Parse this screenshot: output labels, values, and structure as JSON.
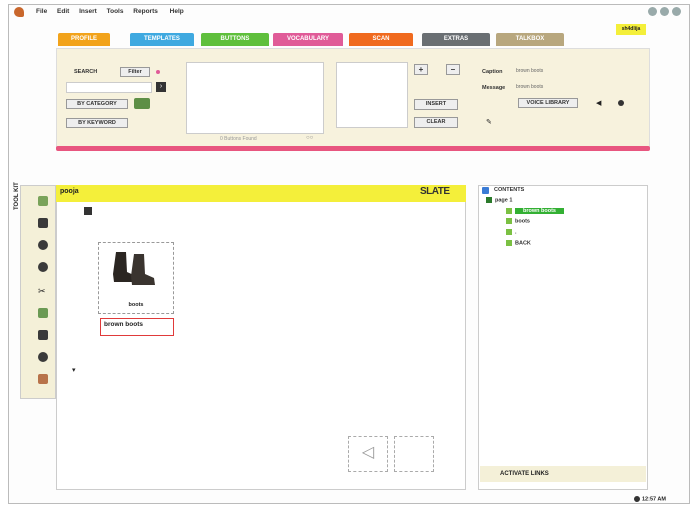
{
  "menu": [
    "File",
    "Edit",
    "Insert",
    "Tools",
    "Reports",
    "Help"
  ],
  "user_badge": "sh4dlija",
  "tabs": [
    {
      "label": "PROFILE",
      "color": "#f2a31b"
    },
    {
      "label": "TEMPLATES",
      "color": "#3fa9e0"
    },
    {
      "label": "BUTTONS",
      "color": "#5fbf3c"
    },
    {
      "label": "VOCABULARY",
      "color": "#e05b98"
    },
    {
      "label": "SCAN",
      "color": "#f06a1e"
    },
    {
      "label": "EXTRAS",
      "color": "#6a6f73"
    },
    {
      "label": "TALKBOX",
      "color": "#b8a77e"
    }
  ],
  "search": {
    "label": "SEARCH",
    "filter_label": "Filter",
    "by_category_label": "BY CATEGORY",
    "by_keyword_label": "BY KEYWORD",
    "hint": "0 Buttons Found"
  },
  "actions": {
    "insert_label": "INSERT",
    "clear_label": "CLEAR",
    "plus_label": "+",
    "minus_label": "–"
  },
  "fields": {
    "caption_label": "Caption",
    "caption_value": "brown boots",
    "message_label": "Message",
    "message_value": "brown boots",
    "voice_library_label": "VOICE LIBRARY"
  },
  "toolkit_label": "TOOL KIT",
  "slate": {
    "title": "pooja",
    "logo": "SLATE",
    "button_caption": "boots",
    "button_label": "brown boots"
  },
  "contents": {
    "title": "CONTENTS",
    "page": "page 1",
    "items": [
      "brown boots",
      "boots",
      ".",
      "BACK"
    ],
    "activate_links_label": "ACTIVATE LINKS"
  },
  "clock": "12:57 AM"
}
